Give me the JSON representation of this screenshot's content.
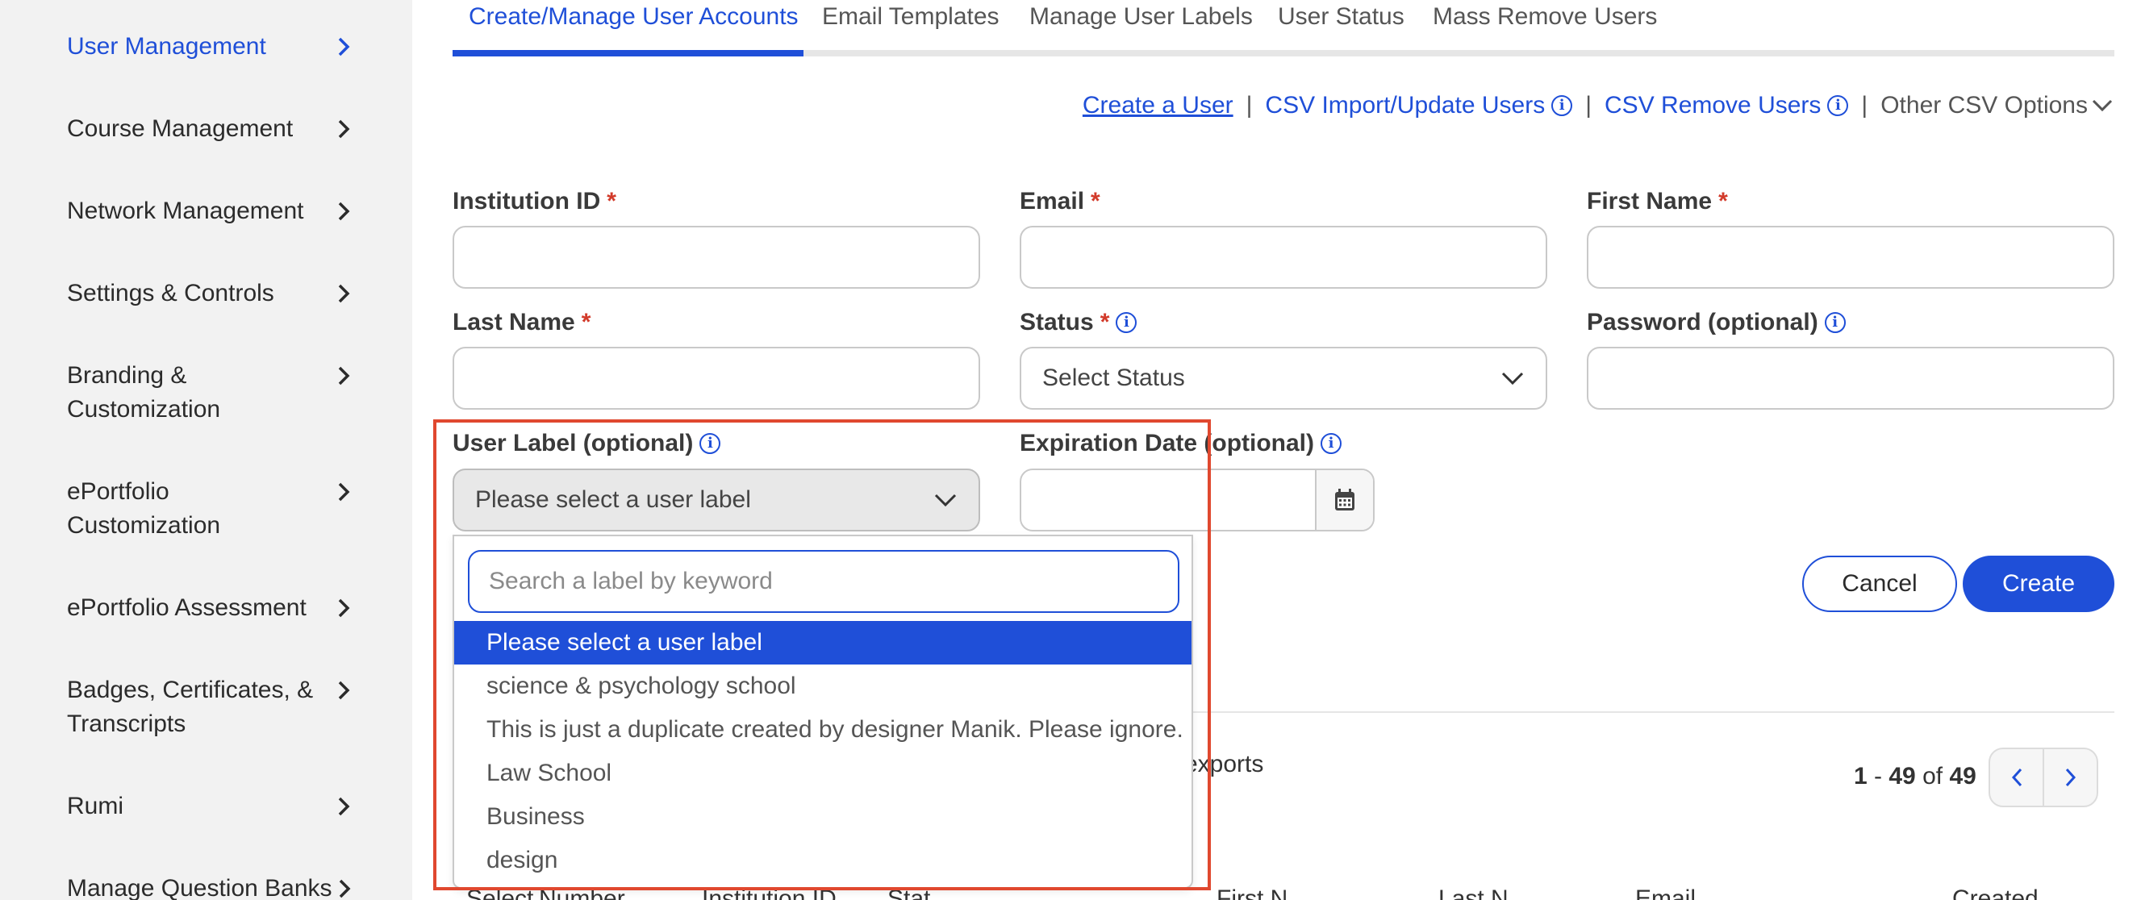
{
  "sidebar": {
    "items": [
      {
        "label": "User Management",
        "active": true
      },
      {
        "label": "Course Management"
      },
      {
        "label": "Network Management"
      },
      {
        "label": "Settings & Controls"
      },
      {
        "label": "Branding & Customization"
      },
      {
        "label": "ePortfolio Customization"
      },
      {
        "label": "ePortfolio Assessment"
      },
      {
        "label": "Badges, Certificates, & Transcripts"
      },
      {
        "label": "Rumi"
      },
      {
        "label": "Manage Question Banks"
      }
    ]
  },
  "tabs": [
    {
      "label": "Create/Manage User Accounts",
      "active": true
    },
    {
      "label": "Email Templates"
    },
    {
      "label": "Manage User Labels"
    },
    {
      "label": "User Status"
    },
    {
      "label": "Mass Remove Users"
    }
  ],
  "actions": {
    "create_user": "Create a User",
    "csv_import": "CSV Import/Update Users",
    "csv_remove": "CSV Remove Users",
    "other_csv": "Other CSV Options",
    "separator": "|"
  },
  "form": {
    "institution_id": {
      "label": "Institution ID",
      "required": "*",
      "value": ""
    },
    "email": {
      "label": "Email",
      "required": "*",
      "value": ""
    },
    "first_name": {
      "label": "First Name",
      "required": "*",
      "value": ""
    },
    "last_name": {
      "label": "Last Name",
      "required": "*",
      "value": ""
    },
    "status": {
      "label": "Status",
      "required": "*",
      "value": "Select Status"
    },
    "password": {
      "label": "Password (optional)",
      "value": ""
    },
    "user_label": {
      "label": "User Label (optional)",
      "value": "Please select a user label"
    },
    "expiration": {
      "label": "Expiration Date (optional)",
      "value": ""
    },
    "info_glyph": "i"
  },
  "buttons": {
    "cancel": "Cancel",
    "create": "Create"
  },
  "dropdown": {
    "search_placeholder": "Search a label by keyword",
    "options": [
      {
        "label": "Please select a user label",
        "selected": true
      },
      {
        "label": "science & psychology school"
      },
      {
        "label": "This is just a duplicate created by designer Manik. Please ignore."
      },
      {
        "label": "Law School"
      },
      {
        "label": "Business"
      },
      {
        "label": "design"
      }
    ]
  },
  "list": {
    "exports_fragment": "exports",
    "pager": {
      "start": "1",
      "dash": " - ",
      "end": "49",
      "of": " of ",
      "total": "49"
    },
    "table_headers_partial": [
      "Select",
      "Number",
      "Institution ID",
      "Stat",
      "First N",
      "Last N",
      "Email",
      "Created"
    ]
  },
  "colors": {
    "accent": "#1f4fd8",
    "required": "#d23a2a",
    "highlight": "#e0482f",
    "sidebar_bg": "#f2f2f2"
  }
}
